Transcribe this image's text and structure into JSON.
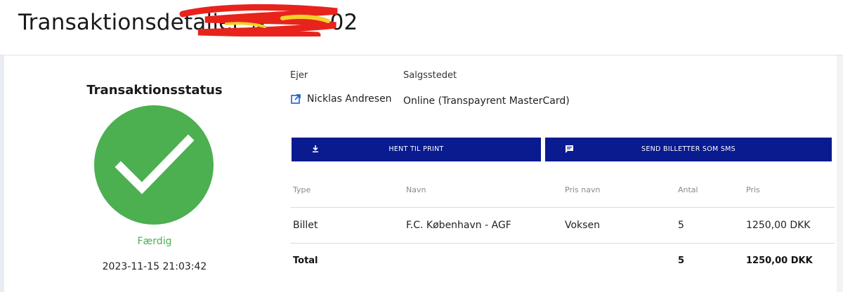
{
  "header": {
    "title": "Transaktionsdetaljer #",
    "id_suffix": "02"
  },
  "status": {
    "title": "Transaktionsstatus",
    "state": "Færdig",
    "datetime": "2023-11-15 21:03:42",
    "color": "#4caf50"
  },
  "meta": {
    "owner_label": "Ejer",
    "owner_name": "Nicklas Andresen",
    "owner_icon": "external-link-icon",
    "sales_label": "Salgsstedet",
    "sales_value": "Online (Transpayrent MasterCard)"
  },
  "actions": {
    "print": {
      "label": "HENT TIL PRINT",
      "icon": "download-icon"
    },
    "sms": {
      "label": "SEND BILLETTER SOM SMS",
      "icon": "message-icon"
    },
    "color": "#0a1a8f"
  },
  "table": {
    "headers": [
      "Type",
      "Navn",
      "Pris navn",
      "Antal",
      "Pris"
    ],
    "rows": [
      [
        "Billet",
        "F.C. København - AGF",
        "Voksen",
        "5",
        "1250,00 DKK"
      ]
    ],
    "total": {
      "label": "Total",
      "count": "5",
      "amount": "1250,00 DKK"
    }
  }
}
